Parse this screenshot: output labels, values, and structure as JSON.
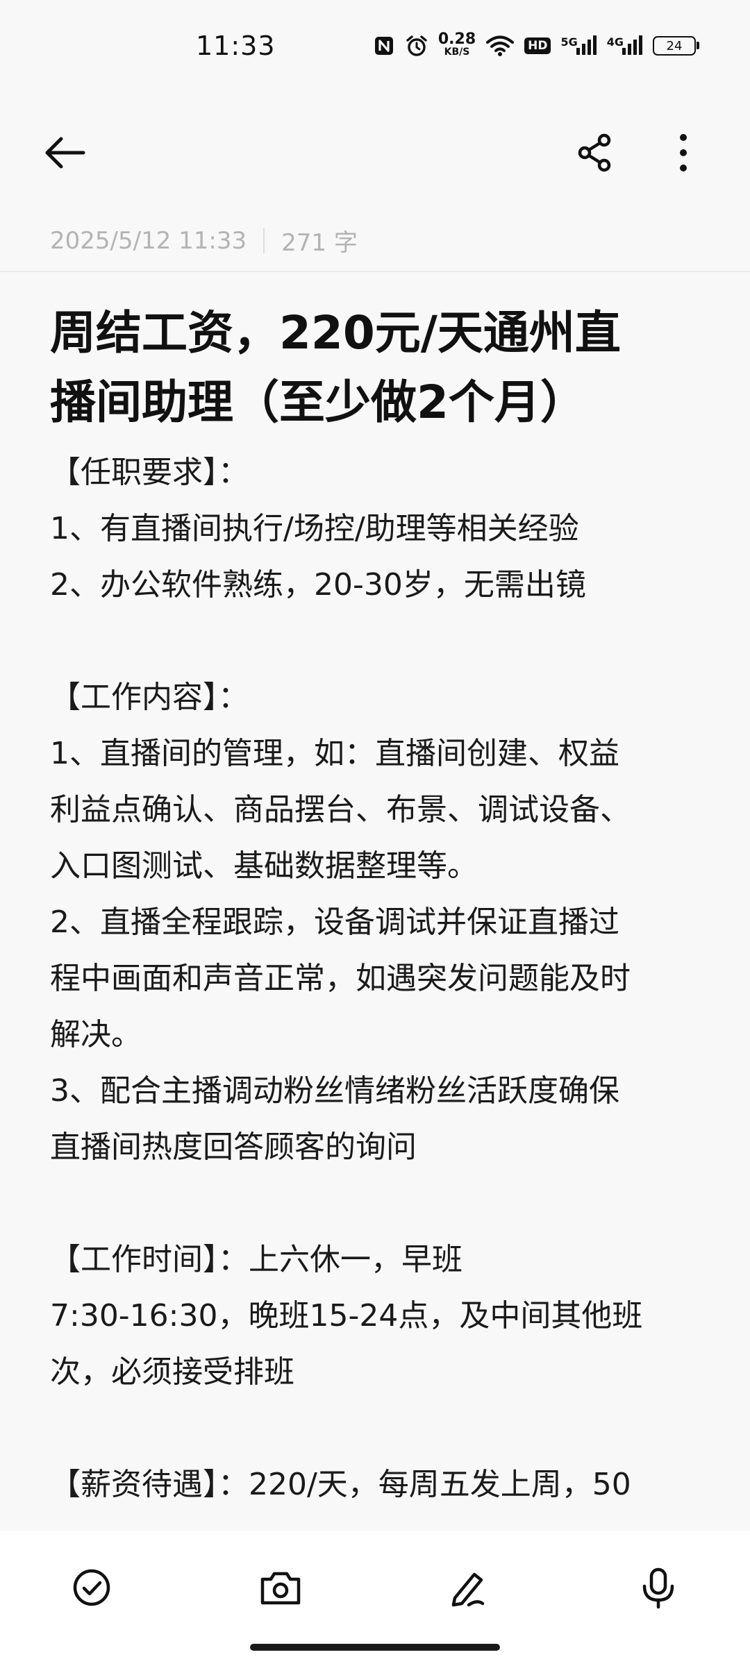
{
  "status_bar": {
    "time": "11:33",
    "net_speed_value": "0.28",
    "net_speed_unit": "KB/S",
    "hd_label": "HD",
    "net_5g": "5G",
    "net_4g": "4G",
    "battery_level": "24",
    "icons": [
      "nfc-icon",
      "alarm-icon",
      "wifi-icon",
      "signal-icon",
      "battery-icon"
    ]
  },
  "toolbar": {
    "icons": [
      "back-arrow-icon",
      "share-icon",
      "more-vertical-icon"
    ]
  },
  "note": {
    "date": "2025/5/12 11:33",
    "word_count": "271 字",
    "title_lines": [
      "周结工资，220元/天通州直",
      "播间助理（至少做2个月）"
    ],
    "body_lines": [
      "【任职要求】：",
      "1、有直播间执行/场控/助理等相关经验",
      "2、办公软件熟练，20-30岁，无需出镜",
      "",
      "【工作内容】：",
      "1、直播间的管理，如：直播间创建、权益",
      "利益点确认、商品摆台、布景、调试设备、",
      "入口图测试、基础数据整理等。",
      "2、直播全程跟踪，设备调试并保证直播过",
      "程中画面和声音正常，如遇突发问题能及时",
      "解决。",
      "3、配合主播调动粉丝情绪粉丝活跃度确保",
      "直播间热度回答顾客的询问",
      "",
      "【工作时间】：上六休一，早班",
      "7:30-16:30，晚班15-24点，及中间其他班",
      "次，必须接受排班",
      "",
      "【薪资待遇】：220/天，每周五发上周，50"
    ]
  },
  "bottom_bar": {
    "icons": [
      "checklist-icon",
      "camera-icon",
      "handwriting-pen-icon",
      "microphone-icon"
    ]
  }
}
